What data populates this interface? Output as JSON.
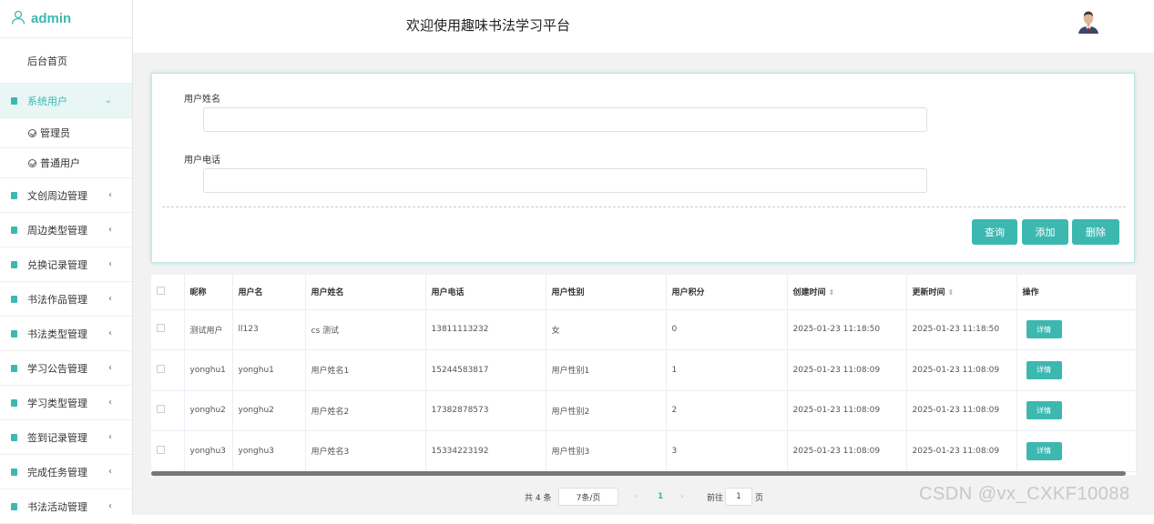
{
  "brand": {
    "title": "admin"
  },
  "header": {
    "title": "欢迎使用趣味书法学习平台"
  },
  "sidebar": {
    "home": "后台首页",
    "active_menu": {
      "label": "系统用户",
      "sub_items": [
        "管理员",
        "普通用户"
      ]
    },
    "items": [
      "文创周边管理",
      "周边类型管理",
      "兑换记录管理",
      "书法作品管理",
      "书法类型管理",
      "学习公告管理",
      "学习类型管理",
      "签到记录管理",
      "完成任务管理",
      "书法活动管理"
    ]
  },
  "search": {
    "name_label": "用户姓名",
    "phone_label": "用户电话",
    "name_value": "",
    "phone_value": "",
    "buttons": {
      "query": "查询",
      "add": "添加",
      "delete": "删除"
    }
  },
  "table": {
    "headers": [
      "昵称",
      "用户名",
      "用户姓名",
      "用户电话",
      "用户性别",
      "用户积分",
      "创建时间",
      "更新时间",
      "操作"
    ],
    "detail_label": "详情",
    "rows": [
      {
        "nickname": "测试用户",
        "username": "ll123",
        "realname": "cs 测试",
        "phone": "13811113232",
        "gender": "女",
        "points": "0",
        "created": "2025-01-23 11:18:50",
        "updated": "2025-01-23 11:18:50"
      },
      {
        "nickname": "yonghu1",
        "username": "yonghu1",
        "realname": "用户姓名1",
        "phone": "15244583817",
        "gender": "用户性别1",
        "points": "1",
        "created": "2025-01-23 11:08:09",
        "updated": "2025-01-23 11:08:09"
      },
      {
        "nickname": "yonghu2",
        "username": "yonghu2",
        "realname": "用户姓名2",
        "phone": "17382878573",
        "gender": "用户性别2",
        "points": "2",
        "created": "2025-01-23 11:08:09",
        "updated": "2025-01-23 11:08:09"
      },
      {
        "nickname": "yonghu3",
        "username": "yonghu3",
        "realname": "用户姓名3",
        "phone": "15334223192",
        "gender": "用户性别3",
        "points": "3",
        "created": "2025-01-23 11:08:09",
        "updated": "2025-01-23 11:08:09"
      }
    ]
  },
  "pagination": {
    "total": "共 4 条",
    "page_size": "7条/页",
    "prev": "‹",
    "current": "1",
    "next": "›",
    "goto_label": "前往",
    "goto_value": "1",
    "page_unit": "页"
  },
  "watermark": "CSDN @vx_CXKF10088",
  "colors": {
    "accent": "#3cb8b1"
  },
  "icons": {
    "brand": "user-icon",
    "menu": "document-icon",
    "sub": "check-circle-icon"
  }
}
